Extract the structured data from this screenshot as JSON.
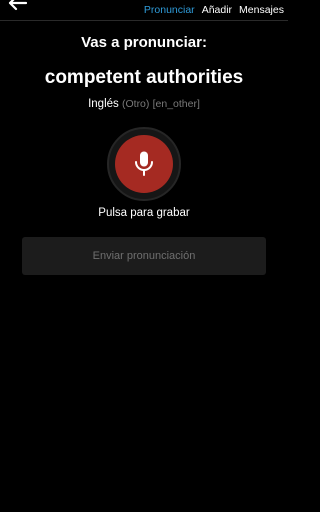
{
  "header": {
    "back_icon": "back-arrow-icon",
    "tabs": [
      {
        "label": "Pronunciar",
        "active": true
      },
      {
        "label": "Añadir",
        "active": false
      },
      {
        "label": "Mensajes",
        "active": false
      }
    ]
  },
  "main": {
    "heading": "Vas a pronunciar:",
    "phrase": "competent authorities",
    "language": {
      "name": "Inglés",
      "variant": "(Otro)",
      "code": "[en_other]"
    },
    "record": {
      "icon": "microphone-icon",
      "label": "Pulsa para grabar"
    },
    "submit_label": "Enviar pronunciación"
  },
  "colors": {
    "background": "#000000",
    "accent_tab": "#2f9bd8",
    "record_button": "#a52a22",
    "disabled_button": "#1c1c1c",
    "muted_text": "#7a7a7a"
  }
}
